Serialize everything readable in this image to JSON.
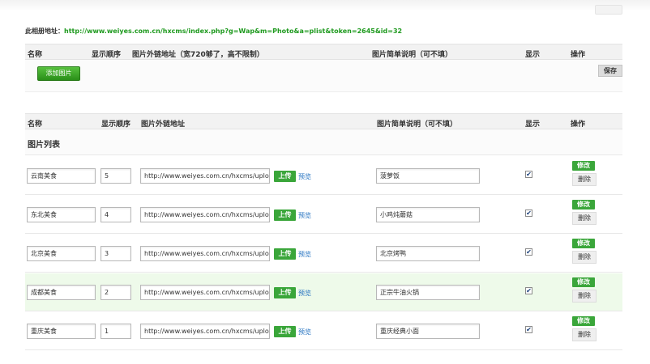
{
  "album": {
    "label": "此相册地址：",
    "url": "http://www.weiyes.com.cn/hxcms/index.php?g=Wap&m=Photo&a=plist&token=2645&id=32"
  },
  "add_section": {
    "headers": [
      "名称",
      "显示顺序",
      "图片外链地址（宽720够了，高不限制）",
      "图片简单说明（可不填）",
      "显示",
      "操作"
    ],
    "add_button": "添加图片",
    "save_button": "保存"
  },
  "list_section": {
    "headers": [
      "名称",
      "显示顺序",
      "图片外链地址",
      "图片简单说明（可不填）",
      "显示",
      "操作"
    ],
    "title": "图片列表"
  },
  "row_labels": {
    "upload": "上传",
    "preview": "预览",
    "edit": "修改",
    "delete": "删除",
    "checkmark": "✔"
  },
  "rows": [
    {
      "name": "云南美食",
      "order": "5",
      "url": "http://www.weiyes.com.cn/hxcms/uploads/i",
      "desc": "菠萝饭",
      "shown": true
    },
    {
      "name": "东北美食",
      "order": "4",
      "url": "http://www.weiyes.com.cn/hxcms/uploads/i",
      "desc": "小鸡炖蘑菇",
      "shown": true
    },
    {
      "name": "北京美食",
      "order": "3",
      "url": "http://www.weiyes.com.cn/hxcms/uploads/i",
      "desc": "北京烤鸭",
      "shown": true
    },
    {
      "name": "成都美食",
      "order": "2",
      "url": "http://www.weiyes.com.cn/hxcms/uploads/i",
      "desc": "正宗牛油火锅",
      "shown": true
    },
    {
      "name": "重庆美食",
      "order": "1",
      "url": "http://www.weiyes.com.cn/hxcms/uploads/i",
      "desc": "重庆经典小面",
      "shown": true
    }
  ],
  "colors": {
    "accent_green": "#3aa63a",
    "url_green": "#1f9a1f",
    "highlight_row": "#eefaea",
    "header_bg": "#f2f2f2"
  }
}
